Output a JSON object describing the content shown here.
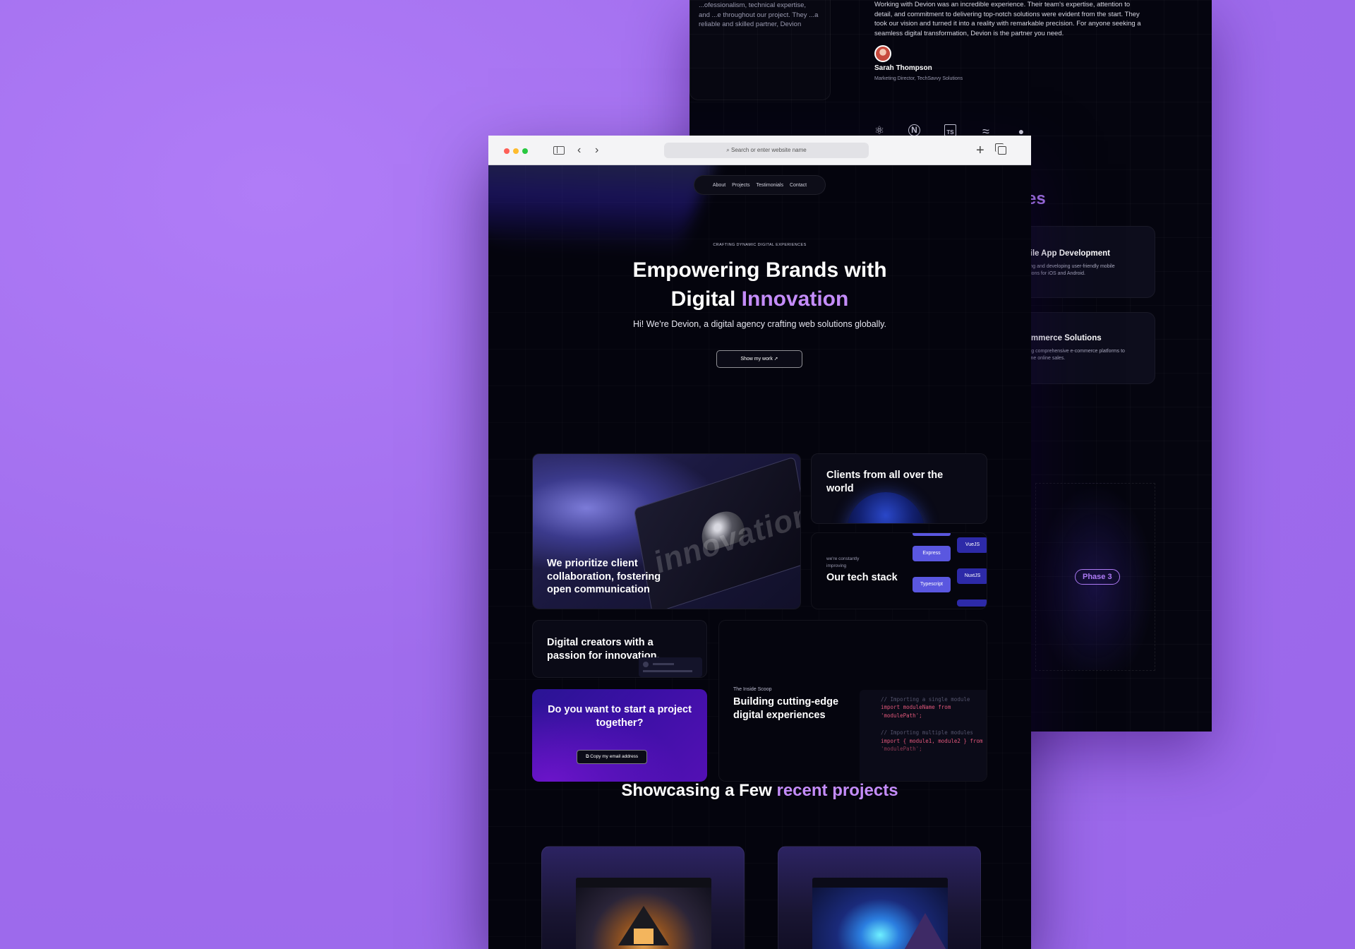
{
  "back_page": {
    "testimonial_left": "...ofessionalism, technical expertise, and ...e throughout our project. They ...a reliable and skilled partner, Devion",
    "testimonial_right": "Working with Devion was an incredible experience. Their team's expertise, attention to detail, and commitment to delivering top-notch solutions were evident from the start. They took our vision and turned it into a reality with remarkable precision. For anyone seeking a seamless digital transformation, Devion is the partner you need.",
    "author_name": "Sarah Thompson",
    "author_role": "Marketing Director, TechSavvy Solutions",
    "tech_icons": [
      "react-icon",
      "nextjs-icon",
      "typescript-icon",
      "tailwind-icon",
      "github-icon"
    ],
    "heading_fragment": "es",
    "services": [
      {
        "title": "Mobile App Development",
        "desc": "Designing and developing user-friendly mobile applications for iOS and Android."
      },
      {
        "title": "E-commerce Solutions",
        "desc": "Providing comprehensive e-commerce platforms to streamline online sales."
      }
    ],
    "phase_label": "Phase 3"
  },
  "browser": {
    "url_placeholder": "Search or enter website name",
    "traffic_lights": [
      "#fe5f57",
      "#febc2e",
      "#28c840"
    ]
  },
  "nav": {
    "items": [
      "About",
      "Projects",
      "Testimonials",
      "Contact"
    ]
  },
  "hero": {
    "eyebrow": "CRAFTING DYNAMIC DIGITAL EXPERIENCES",
    "title_line1": "Empowering Brands with",
    "title_line2_plain": "Digital ",
    "title_line2_accent": "Innovation",
    "subtitle": "Hi! We're Devion, a digital agency crafting web solutions globally.",
    "cta_label": "Show my work",
    "cta_icon": "arrow-up-right-icon"
  },
  "grid": {
    "collab_text": "We prioritize client collaboration, fostering open communication",
    "laptop_word": "innovation",
    "clients_text": "Clients from all over the world",
    "tech_caption": "we're constantly improving",
    "tech_title": "Our tech stack",
    "tech_tags": [
      "Express",
      "Typescript",
      "VueJS",
      "NuxtJS"
    ],
    "creators_text": "Digital creators with a passion for innovation.",
    "cta_title": "Do you want to start a project together?",
    "email_button": "Copy my email address",
    "scoop_caption": "The Inside Scoop",
    "scoop_title": "Building cutting-edge digital experiences",
    "code_lines": [
      "// Importing a single module",
      "import moduleName from",
      "'modulePath';",
      "",
      "// Importing multiple modules",
      "import { module1, module2 } from",
      "'modulePath';"
    ]
  },
  "projects": {
    "title_plain": "Showcasing a Few ",
    "title_accent": "recent projects"
  },
  "colors": {
    "accent": "#c48cf9",
    "background": "#a26ff0",
    "tag_blue": "#5a57e0"
  }
}
